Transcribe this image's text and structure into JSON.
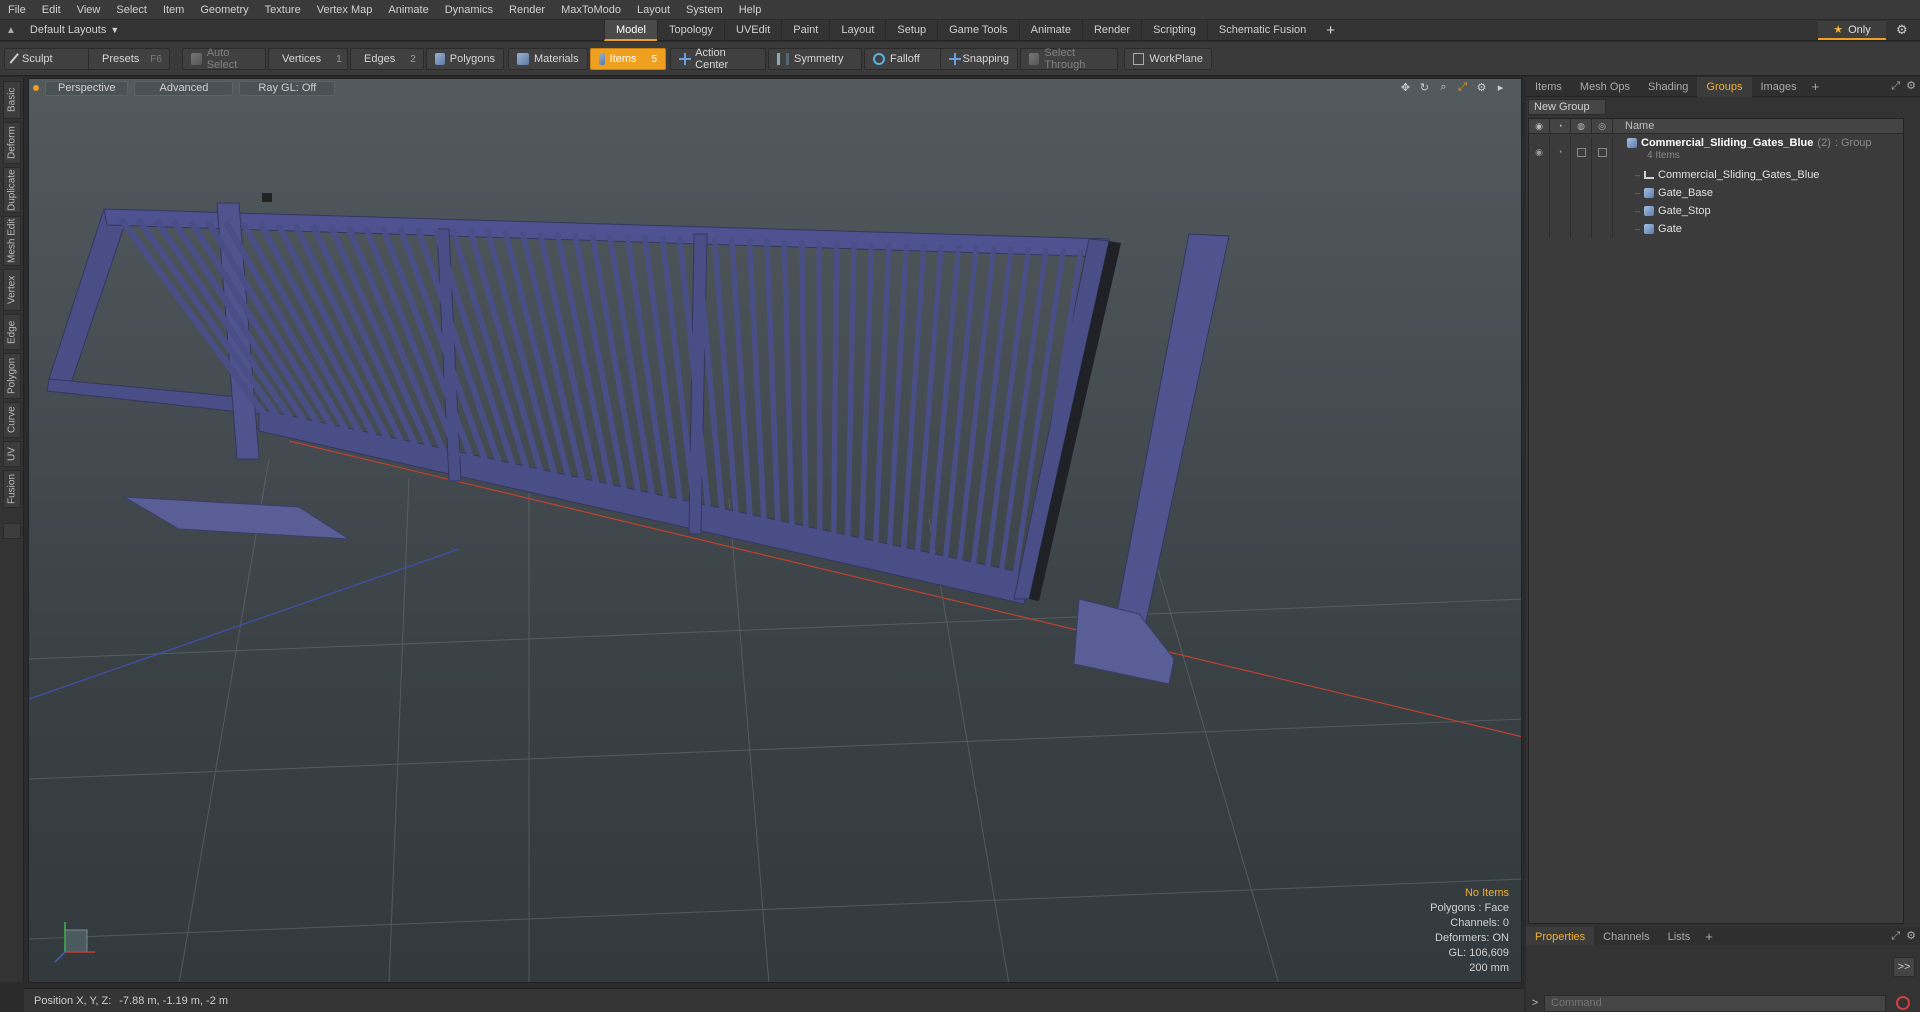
{
  "menu": [
    "File",
    "Edit",
    "View",
    "Select",
    "Item",
    "Geometry",
    "Texture",
    "Vertex Map",
    "Animate",
    "Dynamics",
    "Render",
    "MaxToModo",
    "Layout",
    "System",
    "Help"
  ],
  "layout": {
    "selector": "Default Layouts",
    "tabs": [
      "Model",
      "Topology",
      "UVEdit",
      "Paint",
      "Layout",
      "Setup",
      "Game Tools",
      "Animate",
      "Render",
      "Scripting",
      "Schematic Fusion"
    ],
    "active_tab": "Model",
    "only_label": "Only"
  },
  "toolbar": {
    "sculpt": "Sculpt",
    "presets": "Presets",
    "presets_key": "F6",
    "auto_select": "Auto Select",
    "vertices": "Vertices",
    "vertices_count": "1",
    "edges": "Edges",
    "edges_count": "2",
    "polygons": "Polygons",
    "materials": "Materials",
    "items": "Items",
    "items_count": "5",
    "action_center": "Action Center",
    "symmetry": "Symmetry",
    "falloff": "Falloff",
    "snapping": "Snapping",
    "select_through": "Select Through",
    "workplane": "WorkPlane"
  },
  "left_tabs": [
    "Basic",
    "Deform",
    "Duplicate",
    "Mesh Edit",
    "Vertex",
    "Edge",
    "Polygon",
    "Curve",
    "UV",
    "Fusion"
  ],
  "viewport": {
    "view": "Perspective",
    "mode": "Advanced",
    "raygl": "Ray GL: Off",
    "info": {
      "no_items": "No Items",
      "polygons": "Polygons : Face",
      "channels": "Channels: 0",
      "deformers": "Deformers: ON",
      "gl": "GL: 106,609",
      "scale": "200 mm"
    },
    "colors": {
      "gate": "#4a4e86",
      "grid": "#6a7276",
      "x_axis": "#c04030",
      "z_axis": "#4050b0"
    }
  },
  "status": {
    "label": "Position X, Y, Z:",
    "value": "-7.88 m, -1.19 m, -2 m"
  },
  "right_panel": {
    "tabs": [
      "Items",
      "Mesh Ops",
      "Shading",
      "Groups",
      "Images"
    ],
    "active_tab": "Groups",
    "new_group": "New Group",
    "name_header": "Name",
    "group": {
      "name": "Commercial_Sliding_Gates_Blue",
      "count": "(2)",
      "type": ": Group",
      "items_label": "4 Items"
    },
    "children": [
      "Commercial_Sliding_Gates_Blue",
      "Gate_Base",
      "Gate_Stop",
      "Gate"
    ],
    "bottom_tabs": [
      "Properties",
      "Channels",
      "Lists"
    ],
    "bottom_active": "Properties",
    "side_button": ">>",
    "command_placeholder": "Command"
  }
}
